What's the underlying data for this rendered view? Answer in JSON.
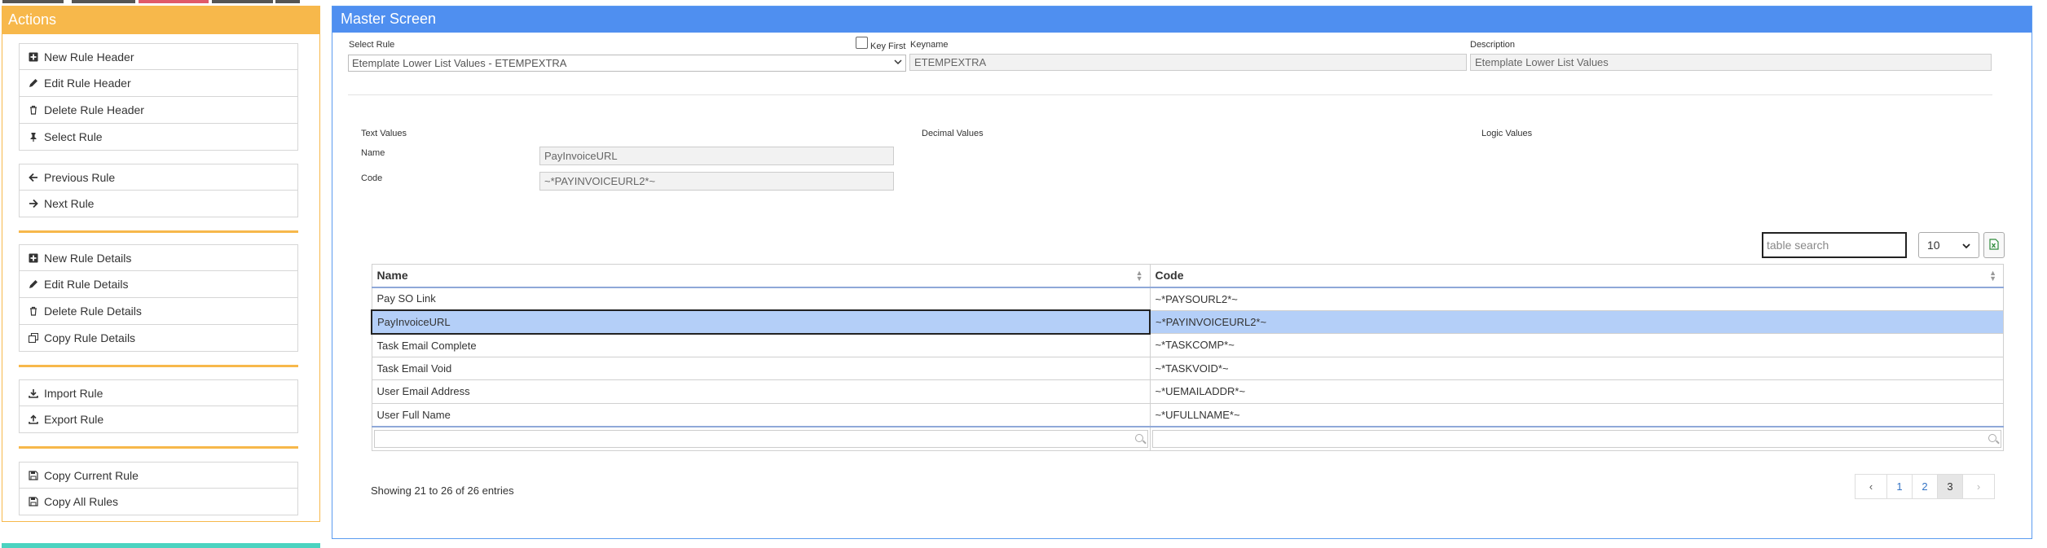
{
  "top_strips": {
    "colors": [
      "#555555",
      "#555555",
      "#e05a6a",
      "#555555",
      "#555555"
    ]
  },
  "actions": {
    "title": "Actions",
    "groups": [
      [
        {
          "label": "New Rule Header",
          "icon": "plus-square-icon"
        },
        {
          "label": "Edit Rule Header",
          "icon": "pencil-icon"
        },
        {
          "label": "Delete Rule Header",
          "icon": "trash-icon"
        },
        {
          "label": "Select Rule",
          "icon": "pin-icon"
        }
      ],
      [
        {
          "label": "Previous Rule",
          "icon": "arrow-left-icon"
        },
        {
          "label": "Next Rule",
          "icon": "arrow-right-icon"
        }
      ],
      [
        {
          "label": "New Rule Details",
          "icon": "plus-square-icon"
        },
        {
          "label": "Edit Rule Details",
          "icon": "pencil-icon"
        },
        {
          "label": "Delete Rule Details",
          "icon": "trash-icon"
        },
        {
          "label": "Copy Rule Details",
          "icon": "copy-icon"
        }
      ],
      [
        {
          "label": "Import Rule",
          "icon": "download-icon"
        },
        {
          "label": "Export Rule",
          "icon": "upload-icon"
        }
      ],
      [
        {
          "label": "Copy Current Rule",
          "icon": "save-icon"
        },
        {
          "label": "Copy All Rules",
          "icon": "save-icon"
        }
      ]
    ]
  },
  "master": {
    "title": "Master Screen",
    "select_rule_label": "Select Rule",
    "select_rule_value": "Etemplate Lower List Values - ETEMPEXTRA",
    "key_first_label": "Key First",
    "keyname_label": "Keyname",
    "keyname_value": "ETEMPEXTRA",
    "description_label": "Description",
    "description_value": "Etemplate Lower List Values",
    "text_values_label": "Text Values",
    "decimal_values_label": "Decimal Values",
    "logic_values_label": "Logic Values",
    "name_label": "Name",
    "name_value": "PayInvoiceURL",
    "code_label": "Code",
    "code_value": "~*PAYINVOICEURL2*~"
  },
  "table": {
    "search_placeholder": "table search",
    "page_size": "10",
    "columns": [
      "Name",
      "Code"
    ],
    "rows": [
      {
        "name": "Pay SO Link",
        "code": "~*PAYSOURL2*~"
      },
      {
        "name": "PayInvoiceURL",
        "code": "~*PAYINVOICEURL2*~"
      },
      {
        "name": "Task Email Complete",
        "code": "~*TASKCOMP*~"
      },
      {
        "name": "Task Email Void",
        "code": "~*TASKVOID*~"
      },
      {
        "name": "User Email Address",
        "code": "~*UEMAILADDR*~"
      },
      {
        "name": "User Full Name",
        "code": "~*UFULLNAME*~"
      }
    ],
    "selected_row": 1,
    "info": "Showing 21 to 26 of 26 entries",
    "pager": {
      "prev": "‹",
      "pages": [
        "1",
        "2",
        "3"
      ],
      "active_page": "3",
      "next": "›"
    }
  }
}
